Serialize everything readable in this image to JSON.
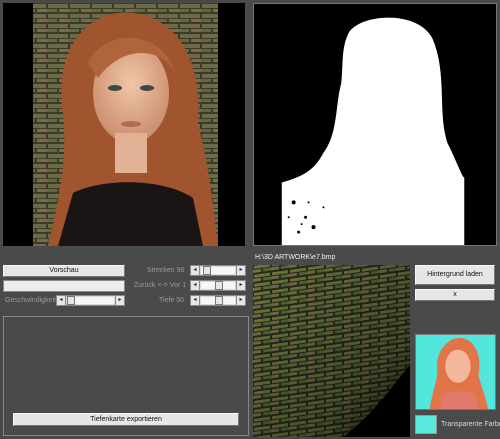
{
  "file_path": "H:\\3D ARTWORK\\e7.bmp",
  "left_controls": {
    "preview_button": "Vorschau",
    "speed_label": "Geschwindigkeit",
    "export_button": "Tiefenkarte exportieren"
  },
  "mid_controls": {
    "stretch_label": "Strecken 96",
    "back_front_label": "Zurück <-> Vor 1",
    "depth_label": "Tiefe 50"
  },
  "right_controls": {
    "background_button": "Hintergrund laden",
    "close_button": "x",
    "transparent_color_label": "Transparente Farbe"
  },
  "colors": {
    "transparent_color": "#57e8de",
    "window_bg": "#4a4a4a"
  },
  "sliders": {
    "stretch": 0.08,
    "back_front": 0.5,
    "depth": 0.5,
    "speed": 0.0
  }
}
